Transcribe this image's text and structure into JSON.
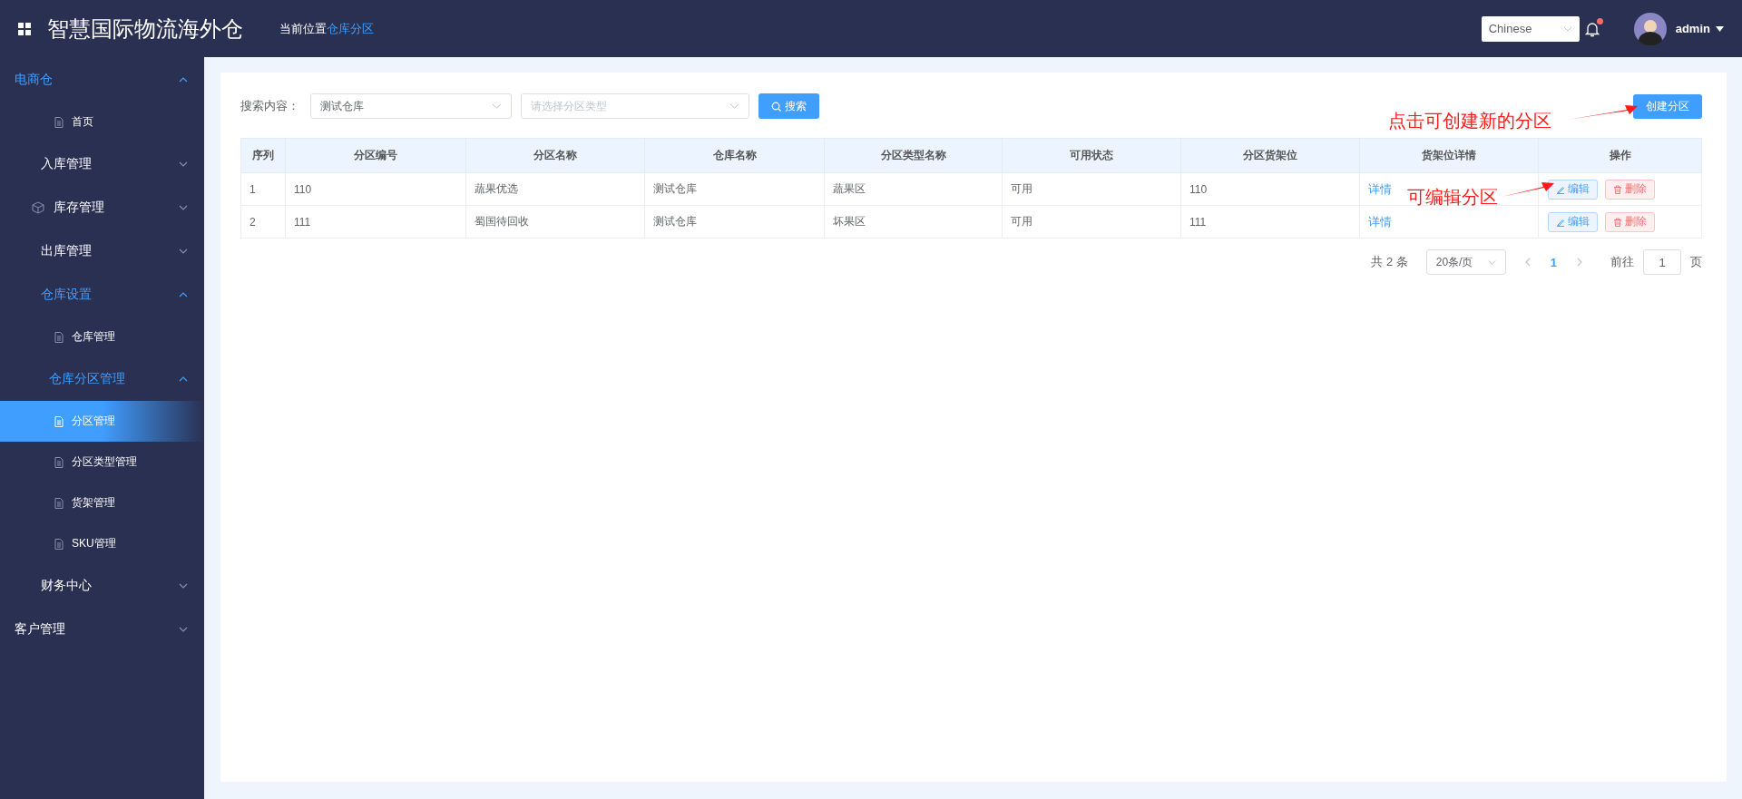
{
  "header": {
    "title": "智慧国际物流海外仓",
    "breadcrumb_label": "当前位置",
    "breadcrumb_current": "仓库分区",
    "language": "Chinese",
    "notification_dot": true,
    "user": "admin"
  },
  "sidebar": {
    "items": [
      {
        "label": "电商仓",
        "kind": "group",
        "expanded": true,
        "children": [
          {
            "label": "首页",
            "kind": "page",
            "selected": false
          },
          {
            "label": "入库管理",
            "kind": "group",
            "expanded": false
          },
          {
            "label": "库存管理",
            "kind": "icon-group",
            "expanded": false
          },
          {
            "label": "出库管理",
            "kind": "group",
            "expanded": false
          },
          {
            "label": "仓库设置",
            "kind": "group",
            "expanded": true,
            "children": [
              {
                "label": "仓库管理",
                "kind": "page",
                "selected": false
              },
              {
                "label": "仓库分区管理",
                "kind": "group",
                "expanded": true,
                "children": [
                  {
                    "label": "分区管理",
                    "kind": "page",
                    "selected": true
                  },
                  {
                    "label": "分区类型管理",
                    "kind": "page",
                    "selected": false
                  },
                  {
                    "label": "货架管理",
                    "kind": "page",
                    "selected": false
                  },
                  {
                    "label": "SKU管理",
                    "kind": "page",
                    "selected": false
                  }
                ]
              }
            ]
          },
          {
            "label": "财务中心",
            "kind": "group",
            "expanded": false
          }
        ]
      },
      {
        "label": "客户管理",
        "kind": "group",
        "expanded": false
      }
    ]
  },
  "search": {
    "label": "搜索内容：",
    "warehouse_value": "测试仓库",
    "type_placeholder": "请选择分区类型",
    "search_button": "搜索",
    "create_button": "创建分区"
  },
  "table": {
    "columns": [
      "序列",
      "分区编号",
      "分区名称",
      "仓库名称",
      "分区类型名称",
      "可用状态",
      "分区货架位",
      "货架位详情",
      "操作"
    ],
    "rows": [
      {
        "cells": [
          "1",
          "110",
          "蔬果优选",
          "测试仓库",
          "蔬果区",
          "可用",
          "110"
        ],
        "detail_link": "详情",
        "actions": [
          "编辑",
          "删除"
        ]
      },
      {
        "cells": [
          "2",
          "111",
          "蜀国待回收",
          "测试仓库",
          "坏果区",
          "可用",
          "111"
        ],
        "detail_link": "详情",
        "actions": [
          "编辑",
          "删除"
        ]
      }
    ]
  },
  "pagination": {
    "total": "共 2 条",
    "page_size": "20条/页",
    "pages": [
      {
        "label": "1",
        "selected": true
      }
    ],
    "goto_label": "前往",
    "goto_value": "1",
    "goto_suffix": "页"
  },
  "annotations": [
    {
      "text": "点击可创建新的分区"
    },
    {
      "text": "可编辑分区"
    }
  ]
}
